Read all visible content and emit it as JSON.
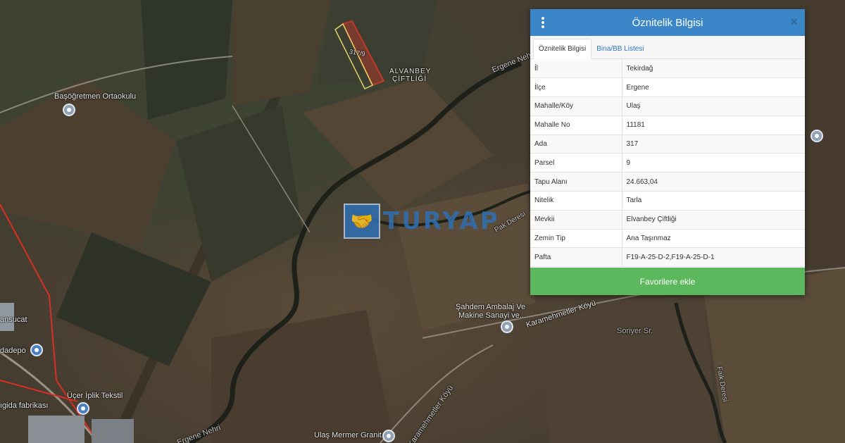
{
  "map": {
    "labels": {
      "alvanbey_line1": "ALVANBEY",
      "alvanbey_line2": "ÇİFTLİĞİ",
      "parcel_label": "317/9",
      "basogretmen": "Başöğretmen Ortaokulu",
      "sahdem_line1": "Şahdem Ambalaj Ve",
      "sahdem_line2": "Makine Sanayi ve...",
      "karamehmetler": "Karamehmetler Köyü",
      "soriyer": "Soriyer Sr.",
      "ucer": "Üçer İplik Tekstil",
      "gida": "ıgida fabrikası",
      "dadepo": "dadepo",
      "ansucat": "ansucat",
      "ulas": "Ulaş Mermer Granit",
      "ergene_nehri_top": "Ergene Nehri",
      "ergene_nehri_bottom": "Ergene Nehri",
      "karamehmetler_road": "Karamehmetler Köyü",
      "pak_deresi": "Pak Deresi",
      "faik_deresi": "Faik Deresi"
    },
    "watermark": {
      "text": "TURYAP",
      "icon": "handshake-icon"
    }
  },
  "panel": {
    "title": "Öznitelik Bilgisi",
    "menu_icon": "kebab-menu-icon",
    "close_icon": "close-icon",
    "close_symbol": "×",
    "tabs": [
      {
        "label": "Öznitelik Bilgisi",
        "active": true
      },
      {
        "label": "Bina/BB Listesi",
        "active": false
      }
    ],
    "rows": [
      {
        "key": "İl",
        "value": "Tekirdağ"
      },
      {
        "key": "İlçe",
        "value": "Ergene"
      },
      {
        "key": "Mahalle/Köy",
        "value": "Ulaş"
      },
      {
        "key": "Mahalle No",
        "value": "11181"
      },
      {
        "key": "Ada",
        "value": "317"
      },
      {
        "key": "Parsel",
        "value": "9"
      },
      {
        "key": "Tapu Alanı",
        "value": "24.663,04"
      },
      {
        "key": "Nitelik",
        "value": "Tarla"
      },
      {
        "key": "Mevkii",
        "value": "Elvanbey Çiftliği"
      },
      {
        "key": "Zemin Tip",
        "value": "Ana Taşınmaz"
      },
      {
        "key": "Pafta",
        "value": "F19-A-25-D-2,F19-A-25-D-1"
      }
    ],
    "favorite_button": "Favorilere ekle"
  },
  "colors": {
    "header": "#3a86c8",
    "favorite_button": "#5cb85c",
    "parcel_highlight": "#c0392b",
    "boundary_line": "#d93025"
  }
}
